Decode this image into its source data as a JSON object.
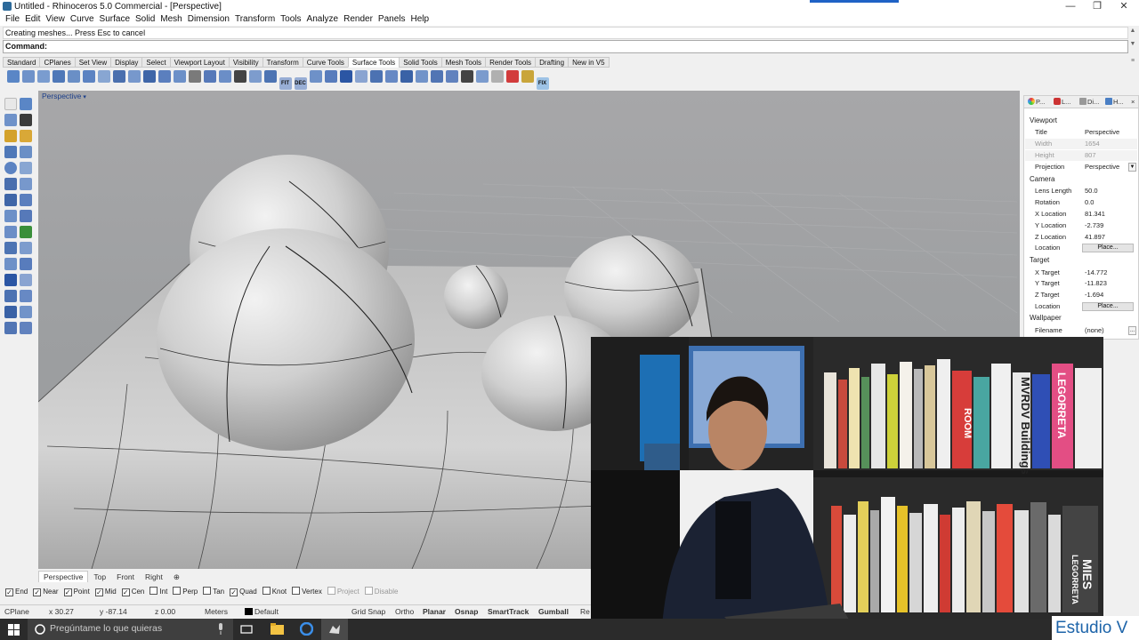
{
  "window": {
    "title": "Untitled - Rhinoceros 5.0 Commercial - [Perspective]",
    "minimize": "—",
    "restore": "❐",
    "close": "✕"
  },
  "menu": [
    "File",
    "Edit",
    "View",
    "Curve",
    "Surface",
    "Solid",
    "Mesh",
    "Dimension",
    "Transform",
    "Tools",
    "Analyze",
    "Render",
    "Panels",
    "Help"
  ],
  "status_message": "Creating meshes... Press Esc to cancel",
  "command": {
    "label": "Command:",
    "value": ""
  },
  "toolbar_tabs": [
    "Standard",
    "CPlanes",
    "Set View",
    "Display",
    "Select",
    "Viewport Layout",
    "Visibility",
    "Transform",
    "Curve Tools",
    "Surface Tools",
    "Solid Tools",
    "Mesh Tools",
    "Render Tools",
    "Drafting",
    "New in V5"
  ],
  "active_toolbar_tab": "Surface Tools",
  "toolbar_icon_labels": {
    "fit": "FIT",
    "dec": "DEC",
    "fix": "FIX"
  },
  "viewport": {
    "label": "Perspective",
    "arrow": "▾"
  },
  "view_tabs": [
    "Perspective",
    "Top",
    "Front",
    "Right",
    "⊕"
  ],
  "osnaps": [
    {
      "label": "End",
      "checked": true
    },
    {
      "label": "Near",
      "checked": true
    },
    {
      "label": "Point",
      "checked": true
    },
    {
      "label": "Mid",
      "checked": true
    },
    {
      "label": "Cen",
      "checked": true
    },
    {
      "label": "Int",
      "checked": false
    },
    {
      "label": "Perp",
      "checked": false
    },
    {
      "label": "Tan",
      "checked": false
    },
    {
      "label": "Quad",
      "checked": true
    },
    {
      "label": "Knot",
      "checked": false
    },
    {
      "label": "Vertex",
      "checked": false
    },
    {
      "label": "Project",
      "checked": false,
      "disabled": true
    },
    {
      "label": "Disable",
      "checked": false,
      "disabled": true
    }
  ],
  "statusbar": {
    "cplane": "CPlane",
    "x": "x 30.27",
    "y": "y -87.14",
    "z": "z 0.00",
    "units": "Meters",
    "layer": "Default",
    "grid_snap": "Grid Snap",
    "ortho": "Ortho",
    "planar": "Planar",
    "osnap": "Osnap",
    "smarttrack": "SmartTrack",
    "gumball": "Gumball",
    "record": "Re"
  },
  "panel": {
    "tabs": [
      "P...",
      "L...",
      "Di...",
      "H..."
    ],
    "viewport_section": "Viewport",
    "title_key": "Title",
    "title_val": "Perspective",
    "width_key": "Width",
    "width_val": "1654",
    "height_key": "Height",
    "height_val": "807",
    "projection_key": "Projection",
    "projection_val": "Perspective",
    "camera_section": "Camera",
    "lens_key": "Lens Length",
    "lens_val": "50.0",
    "rotation_key": "Rotation",
    "rotation_val": "0.0",
    "xloc_key": "X Location",
    "xloc_val": "81.341",
    "yloc_key": "Y Location",
    "yloc_val": "-2.739",
    "zloc_key": "Z Location",
    "zloc_val": "41.897",
    "loc_key": "Location",
    "place_btn": "Place...",
    "target_section": "Target",
    "xtar_key": "X Target",
    "xtar_val": "-14.772",
    "ytar_key": "Y Target",
    "ytar_val": "-11.823",
    "ztar_key": "Z Target",
    "ztar_val": "-1.694",
    "tloc_key": "Location",
    "tplace_btn": "Place...",
    "wallpaper_section": "Wallpaper",
    "filename_key": "Filename",
    "filename_val": "(none)",
    "browse_btn": "..."
  },
  "video": {
    "book_titles": [
      "ROOM",
      "MVRDV Buildings",
      "LEGORRETA",
      "MIES",
      "LEGORRETA"
    ]
  },
  "taskbar": {
    "search_placeholder": "Pregúntame lo que quieras"
  },
  "watermark": "Estudio V",
  "colors": {
    "accent": "#1f62c5",
    "viewport_bg": "#a0a1a3",
    "taskbar": "#2b2b2b"
  }
}
